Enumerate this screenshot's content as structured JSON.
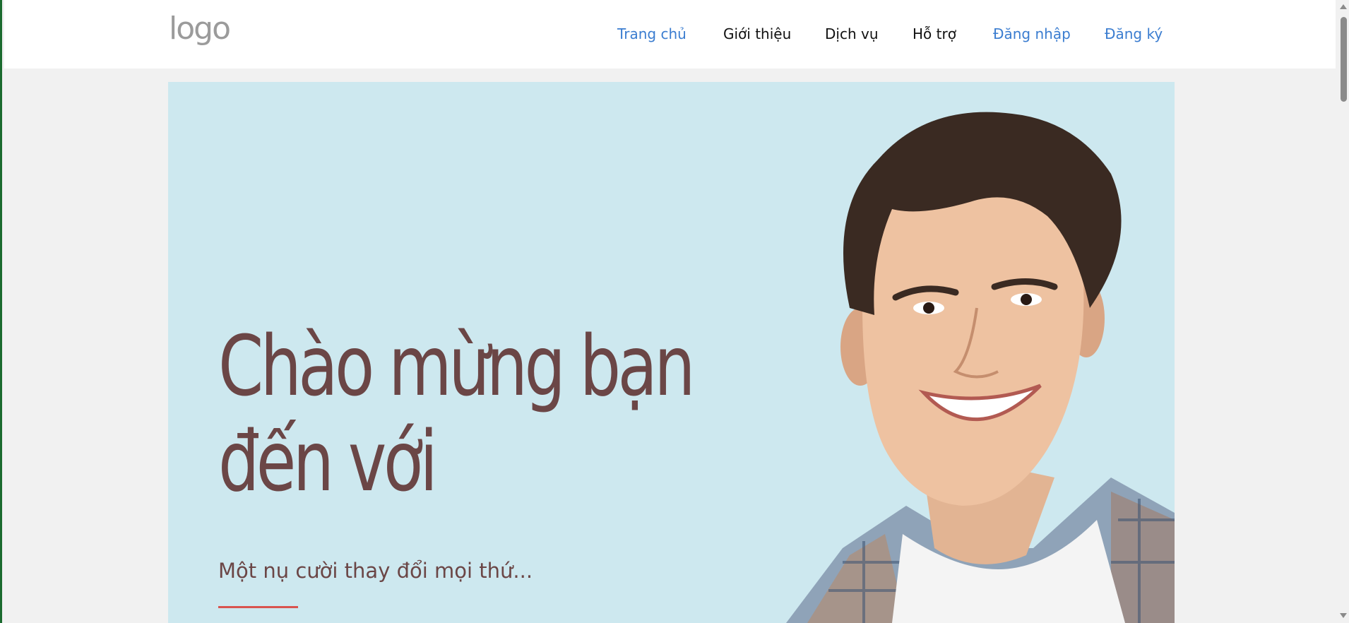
{
  "header": {
    "logo_text": "logo",
    "nav": [
      {
        "label": "Trang chủ",
        "accent": true
      },
      {
        "label": "Giới thiệu",
        "accent": false
      },
      {
        "label": "Dịch vụ",
        "accent": false
      },
      {
        "label": "Hỗ trợ",
        "accent": false
      },
      {
        "label": "Đăng nhập",
        "accent": true
      },
      {
        "label": "Đăng ký",
        "accent": true
      }
    ]
  },
  "hero": {
    "title_line1": "Chào mừng bạn",
    "title_line2": "đến với",
    "subtitle": "Một nụ cười thay đổi mọi thứ...",
    "photo_icon": "smiling-young-man-photo"
  },
  "colors": {
    "accent_link": "#3b7dd0",
    "hero_background": "#cde8ef",
    "title_text": "#6b4646",
    "underline": "#d9534f",
    "logo": "#9b9b9b"
  }
}
